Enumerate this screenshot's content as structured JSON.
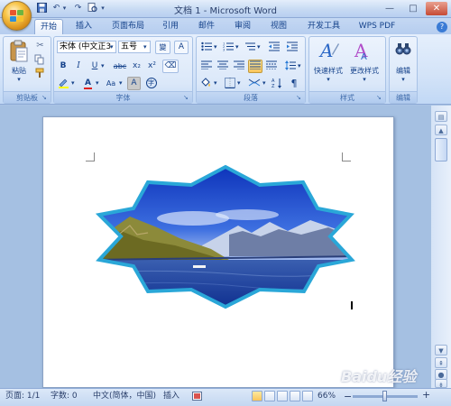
{
  "app": {
    "title": "文档 1 - Microsoft Word",
    "quick_access": {
      "save_icon": "save-icon",
      "undo": "↶",
      "redo": "↷",
      "customize": "▾"
    },
    "window_controls": {
      "minimize": "—",
      "maximize": "□",
      "close": "✕"
    }
  },
  "tabs": [
    {
      "label": "开始",
      "active": true
    },
    {
      "label": "插入"
    },
    {
      "label": "页面布局"
    },
    {
      "label": "引用"
    },
    {
      "label": "邮件"
    },
    {
      "label": "审阅"
    },
    {
      "label": "视图"
    },
    {
      "label": "开发工具"
    },
    {
      "label": "WPS PDF"
    }
  ],
  "ribbon": {
    "clipboard": {
      "label": "剪贴板",
      "paste": "粘贴"
    },
    "font": {
      "label": "字体",
      "font_name": "宋体 (中文正3",
      "font_size": "五号",
      "grow": "A",
      "clear": "A",
      "bold": "B",
      "italic": "I",
      "underline": "U",
      "strike": "abc",
      "subscript": "x₂",
      "superscript": "x²",
      "change_case": "Aa",
      "char_shade": "A",
      "enclose": "字"
    },
    "paragraph": {
      "label": "段落"
    },
    "styles": {
      "label": "样式",
      "quick_styles": "快速样式",
      "change_styles": "更改样式"
    },
    "editing": {
      "label": "编辑",
      "edit": "编辑"
    }
  },
  "status": {
    "page": "页面: 1/1",
    "words": "字数: 0",
    "language": "中文(简体，中国)",
    "mode": "插入",
    "zoom": "66%",
    "zoom_minus": "−",
    "zoom_plus": "+"
  },
  "watermark": "Baidu经验",
  "colors": {
    "accent": "#15428b",
    "shape_border": "#2aa7d8",
    "highlight": "#f9c55b"
  }
}
